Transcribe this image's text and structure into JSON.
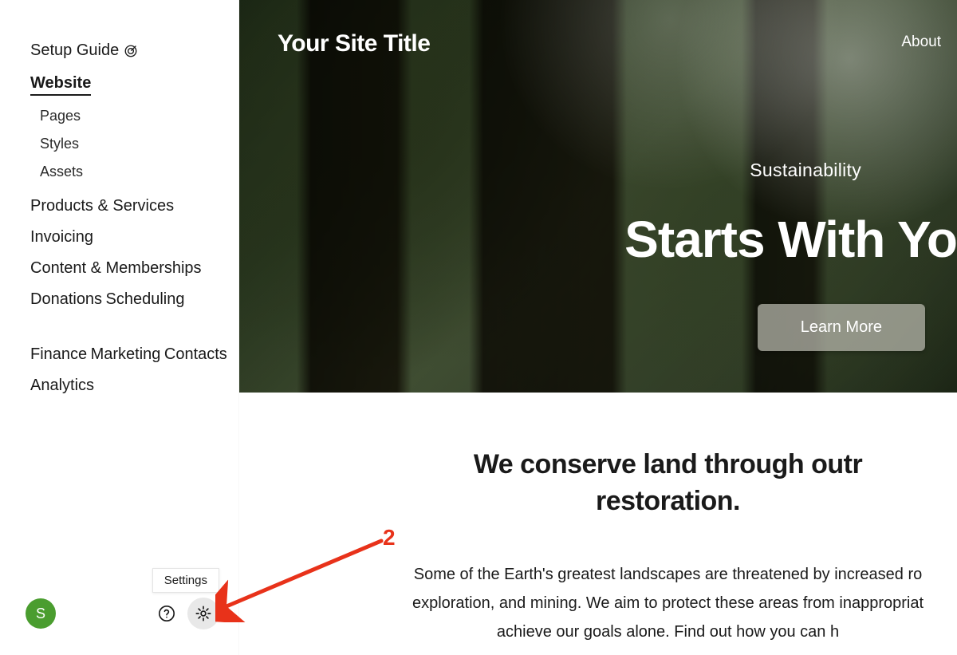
{
  "sidebar": {
    "setup_label": "Setup Guide",
    "items_primary": [
      {
        "label": "Website",
        "active": true
      },
      {
        "label": "Products & Services"
      },
      {
        "label": "Invoicing"
      },
      {
        "label": "Content & Memberships"
      },
      {
        "label": "Donations"
      },
      {
        "label": "Scheduling"
      }
    ],
    "website_children": [
      {
        "label": "Pages"
      },
      {
        "label": "Styles"
      },
      {
        "label": "Assets"
      }
    ],
    "items_secondary": [
      {
        "label": "Finance"
      },
      {
        "label": "Marketing"
      },
      {
        "label": "Contacts"
      },
      {
        "label": "Analytics"
      }
    ],
    "avatar_initial": "S",
    "settings_tooltip": "Settings"
  },
  "preview": {
    "site_title": "Your Site Title",
    "nav_link": "About",
    "hero_eyebrow": "Sustainability",
    "hero_heading": "Starts With Yo",
    "hero_cta": "Learn More",
    "body_heading_l1": "We conserve land through outr",
    "body_heading_l2": "restoration.",
    "body_text_l1": "Some of the Earth's greatest landscapes are threatened by increased ro",
    "body_text_l2": "exploration, and mining. We aim to protect these areas from inappropriat",
    "body_text_l3": "achieve our goals alone. Find out how you can h"
  },
  "annotation": {
    "number": "2"
  }
}
